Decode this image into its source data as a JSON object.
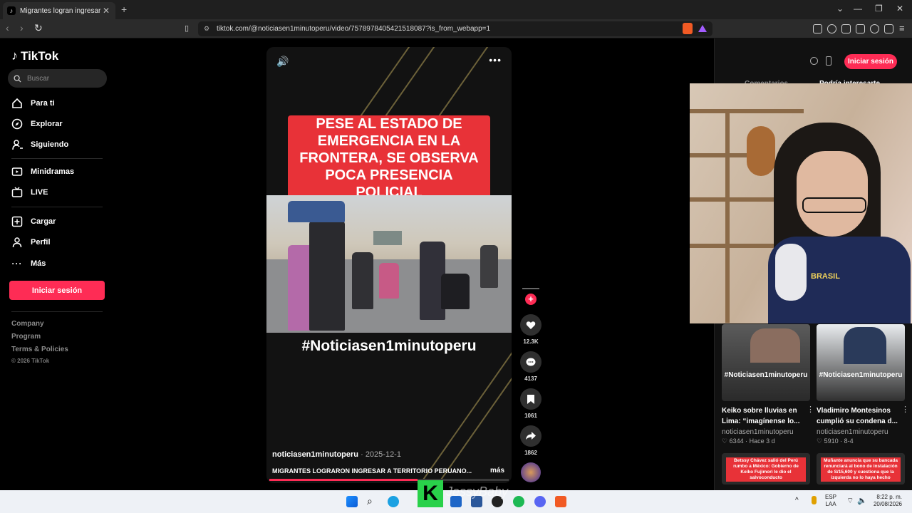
{
  "browser": {
    "tab_title": "Migrantes logran ingresar a P",
    "tab_close": "✕",
    "new_tab": "+",
    "url": "tiktok.com/@noticiasen1minutoperu/video/7578978405421518087?is_from_webapp=1",
    "window_controls": [
      "⌄",
      "—",
      "❐",
      "✕"
    ]
  },
  "sidebar": {
    "logo": "TikTok",
    "search_placeholder": "Buscar",
    "nav": [
      {
        "label": "Para ti",
        "icon": "home-icon"
      },
      {
        "label": "Explorar",
        "icon": "compass-icon"
      },
      {
        "label": "Siguiendo",
        "icon": "following-icon"
      },
      {
        "label": "Minidramas",
        "icon": "minidrama-icon"
      },
      {
        "label": "LIVE",
        "icon": "live-icon"
      },
      {
        "label": "Cargar",
        "icon": "upload-icon"
      },
      {
        "label": "Perfil",
        "icon": "profile-icon"
      },
      {
        "label": "Más",
        "icon": "more-icon"
      }
    ],
    "login_button": "Iniciar sesión",
    "footer_links": [
      "Company",
      "Program",
      "Terms & Policies"
    ],
    "copyright": "© 2026 TikTok"
  },
  "video": {
    "headline": "PESE AL ESTADO DE EMERGENCIA EN LA FRONTERA, SE OBSERVA POCA PRESENCIA POLICIAL",
    "hashtag": "#Noticiasen1minutoperu",
    "author": "noticiasen1minutoperu",
    "date": "· 2025-12-1",
    "caption": "MIGRANTES LOGRARON INGRESAR A TERRITORIO PERUANO...",
    "more": "más",
    "progress": 0.62
  },
  "actions": {
    "likes": "12.3K",
    "comments": "4137",
    "saves": "1061",
    "shares": "1862"
  },
  "right_panel": {
    "login_button": "Iniciar sesión",
    "tab_comments": "Comentarios",
    "tab_suggested": "Podría interesarte"
  },
  "cards": [
    {
      "thumb_tag": "#Noticiasen1minutoperu",
      "title": "Keiko sobre lluvias en Lima: “imagínense lo...",
      "author": "noticiasen1minutoperu",
      "views": "6344",
      "age": "Hace 3 d"
    },
    {
      "thumb_tag": "#Noticiasen1minutoperu",
      "title": "Vladimiro Montesinos cumplió su condena d...",
      "author": "noticiasen1minutoperu",
      "views": "5910",
      "age": "8-4"
    }
  ],
  "more_cards": [
    "Betssy Chávez salió del Perú rumbo a México: Gobierno de Keiko Fujimori le dio el salvoconducto",
    "Muñante anuncia que su bancada renunciará al bono de instalación de S/15,600 y cuestiona que la izquierda no lo haya hecho"
  ],
  "webcam": {
    "shirt_text": "BRASIL"
  },
  "stream_overlay": {
    "badge": "K",
    "name": "JessyBaby"
  },
  "taskbar": {
    "lang_top": "ESP",
    "lang_bottom": "LAA",
    "time": "8:22 p. m.",
    "date": "20/08/2026"
  }
}
